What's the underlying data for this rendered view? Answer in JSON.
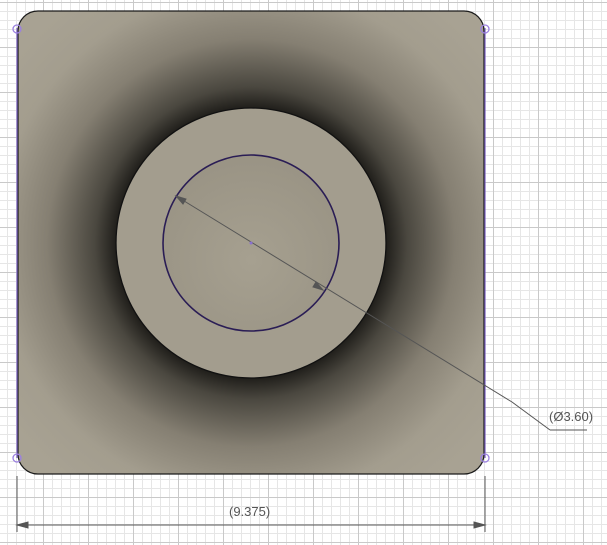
{
  "dimensions": {
    "diameter_label": "(Ø3.60)",
    "width_label": "(9.375)"
  },
  "colors": {
    "body": "#a39d8e",
    "sketch_line": "#6a4fb0",
    "edge": "#1a1a1a"
  }
}
